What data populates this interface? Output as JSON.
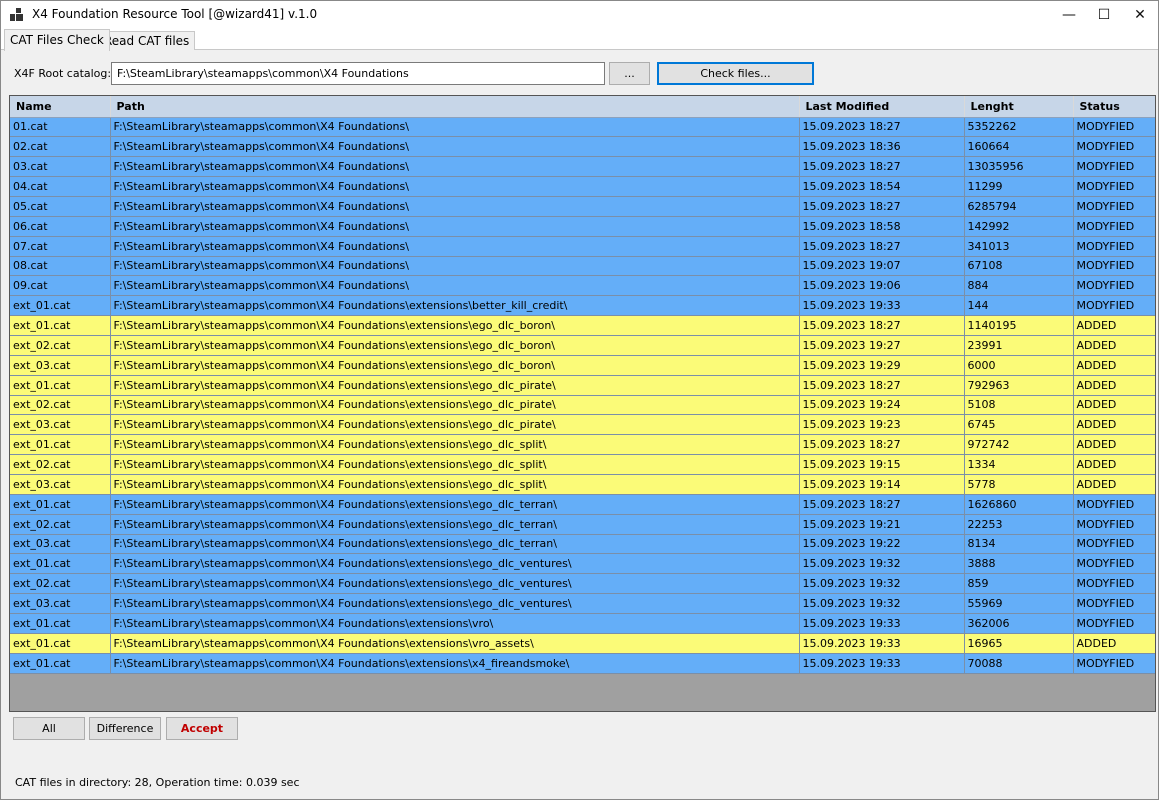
{
  "window": {
    "title": "X4 Foundation Resource Tool [@wizard41] v.1.0",
    "minimize_glyph": "—",
    "maximize_glyph": "☐",
    "close_glyph": "✕"
  },
  "tabs": [
    {
      "label": "CAT Files Check",
      "active": true
    },
    {
      "label": "Read CAT files",
      "active": false
    }
  ],
  "toolbar": {
    "root_label": "X4F Root catalog:",
    "root_value": "F:\\SteamLibrary\\steamapps\\common\\X4 Foundations",
    "browse_label": "...",
    "check_label": "Check files..."
  },
  "grid": {
    "columns": [
      "Name",
      "Path",
      "Last Modified",
      "Lenght",
      "Status"
    ],
    "rows": [
      {
        "name": "01.cat",
        "path": "F:\\SteamLibrary\\steamapps\\common\\X4 Foundations\\",
        "modified": "15.09.2023 18:27",
        "length": "5352262",
        "status": "MODYFIED"
      },
      {
        "name": "02.cat",
        "path": "F:\\SteamLibrary\\steamapps\\common\\X4 Foundations\\",
        "modified": "15.09.2023 18:36",
        "length": "160664",
        "status": "MODYFIED"
      },
      {
        "name": "03.cat",
        "path": "F:\\SteamLibrary\\steamapps\\common\\X4 Foundations\\",
        "modified": "15.09.2023 18:27",
        "length": "13035956",
        "status": "MODYFIED"
      },
      {
        "name": "04.cat",
        "path": "F:\\SteamLibrary\\steamapps\\common\\X4 Foundations\\",
        "modified": "15.09.2023 18:54",
        "length": "11299",
        "status": "MODYFIED"
      },
      {
        "name": "05.cat",
        "path": "F:\\SteamLibrary\\steamapps\\common\\X4 Foundations\\",
        "modified": "15.09.2023 18:27",
        "length": "6285794",
        "status": "MODYFIED"
      },
      {
        "name": "06.cat",
        "path": "F:\\SteamLibrary\\steamapps\\common\\X4 Foundations\\",
        "modified": "15.09.2023 18:58",
        "length": "142992",
        "status": "MODYFIED"
      },
      {
        "name": "07.cat",
        "path": "F:\\SteamLibrary\\steamapps\\common\\X4 Foundations\\",
        "modified": "15.09.2023 18:27",
        "length": "341013",
        "status": "MODYFIED"
      },
      {
        "name": "08.cat",
        "path": "F:\\SteamLibrary\\steamapps\\common\\X4 Foundations\\",
        "modified": "15.09.2023 19:07",
        "length": "67108",
        "status": "MODYFIED"
      },
      {
        "name": "09.cat",
        "path": "F:\\SteamLibrary\\steamapps\\common\\X4 Foundations\\",
        "modified": "15.09.2023 19:06",
        "length": "884",
        "status": "MODYFIED"
      },
      {
        "name": "ext_01.cat",
        "path": "F:\\SteamLibrary\\steamapps\\common\\X4 Foundations\\extensions\\better_kill_credit\\",
        "modified": "15.09.2023 19:33",
        "length": "144",
        "status": "MODYFIED"
      },
      {
        "name": "ext_01.cat",
        "path": "F:\\SteamLibrary\\steamapps\\common\\X4 Foundations\\extensions\\ego_dlc_boron\\",
        "modified": "15.09.2023 18:27",
        "length": "1140195",
        "status": "ADDED"
      },
      {
        "name": "ext_02.cat",
        "path": "F:\\SteamLibrary\\steamapps\\common\\X4 Foundations\\extensions\\ego_dlc_boron\\",
        "modified": "15.09.2023 19:27",
        "length": "23991",
        "status": "ADDED"
      },
      {
        "name": "ext_03.cat",
        "path": "F:\\SteamLibrary\\steamapps\\common\\X4 Foundations\\extensions\\ego_dlc_boron\\",
        "modified": "15.09.2023 19:29",
        "length": "6000",
        "status": "ADDED"
      },
      {
        "name": "ext_01.cat",
        "path": "F:\\SteamLibrary\\steamapps\\common\\X4 Foundations\\extensions\\ego_dlc_pirate\\",
        "modified": "15.09.2023 18:27",
        "length": "792963",
        "status": "ADDED"
      },
      {
        "name": "ext_02.cat",
        "path": "F:\\SteamLibrary\\steamapps\\common\\X4 Foundations\\extensions\\ego_dlc_pirate\\",
        "modified": "15.09.2023 19:24",
        "length": "5108",
        "status": "ADDED"
      },
      {
        "name": "ext_03.cat",
        "path": "F:\\SteamLibrary\\steamapps\\common\\X4 Foundations\\extensions\\ego_dlc_pirate\\",
        "modified": "15.09.2023 19:23",
        "length": "6745",
        "status": "ADDED"
      },
      {
        "name": "ext_01.cat",
        "path": "F:\\SteamLibrary\\steamapps\\common\\X4 Foundations\\extensions\\ego_dlc_split\\",
        "modified": "15.09.2023 18:27",
        "length": "972742",
        "status": "ADDED"
      },
      {
        "name": "ext_02.cat",
        "path": "F:\\SteamLibrary\\steamapps\\common\\X4 Foundations\\extensions\\ego_dlc_split\\",
        "modified": "15.09.2023 19:15",
        "length": "1334",
        "status": "ADDED"
      },
      {
        "name": "ext_03.cat",
        "path": "F:\\SteamLibrary\\steamapps\\common\\X4 Foundations\\extensions\\ego_dlc_split\\",
        "modified": "15.09.2023 19:14",
        "length": "5778",
        "status": "ADDED"
      },
      {
        "name": "ext_01.cat",
        "path": "F:\\SteamLibrary\\steamapps\\common\\X4 Foundations\\extensions\\ego_dlc_terran\\",
        "modified": "15.09.2023 18:27",
        "length": "1626860",
        "status": "MODYFIED"
      },
      {
        "name": "ext_02.cat",
        "path": "F:\\SteamLibrary\\steamapps\\common\\X4 Foundations\\extensions\\ego_dlc_terran\\",
        "modified": "15.09.2023 19:21",
        "length": "22253",
        "status": "MODYFIED"
      },
      {
        "name": "ext_03.cat",
        "path": "F:\\SteamLibrary\\steamapps\\common\\X4 Foundations\\extensions\\ego_dlc_terran\\",
        "modified": "15.09.2023 19:22",
        "length": "8134",
        "status": "MODYFIED"
      },
      {
        "name": "ext_01.cat",
        "path": "F:\\SteamLibrary\\steamapps\\common\\X4 Foundations\\extensions\\ego_dlc_ventures\\",
        "modified": "15.09.2023 19:32",
        "length": "3888",
        "status": "MODYFIED"
      },
      {
        "name": "ext_02.cat",
        "path": "F:\\SteamLibrary\\steamapps\\common\\X4 Foundations\\extensions\\ego_dlc_ventures\\",
        "modified": "15.09.2023 19:32",
        "length": "859",
        "status": "MODYFIED"
      },
      {
        "name": "ext_03.cat",
        "path": "F:\\SteamLibrary\\steamapps\\common\\X4 Foundations\\extensions\\ego_dlc_ventures\\",
        "modified": "15.09.2023 19:32",
        "length": "55969",
        "status": "MODYFIED"
      },
      {
        "name": "ext_01.cat",
        "path": "F:\\SteamLibrary\\steamapps\\common\\X4 Foundations\\extensions\\vro\\",
        "modified": "15.09.2023 19:33",
        "length": "362006",
        "status": "MODYFIED"
      },
      {
        "name": "ext_01.cat",
        "path": "F:\\SteamLibrary\\steamapps\\common\\X4 Foundations\\extensions\\vro_assets\\",
        "modified": "15.09.2023 19:33",
        "length": "16965",
        "status": "ADDED"
      },
      {
        "name": "ext_01.cat",
        "path": "F:\\SteamLibrary\\steamapps\\common\\X4 Foundations\\extensions\\x4_fireandsmoke\\",
        "modified": "15.09.2023 19:33",
        "length": "70088",
        "status": "MODYFIED"
      }
    ]
  },
  "actions": {
    "all_label": "All",
    "difference_label": "Difference",
    "accept_label": "Accept"
  },
  "status_text": "CAT files in directory: 28, Operation time: 0.039 sec",
  "colors": {
    "modified_row": "#64aef8",
    "added_row": "#fbfb78",
    "accept_text": "#c00000"
  }
}
